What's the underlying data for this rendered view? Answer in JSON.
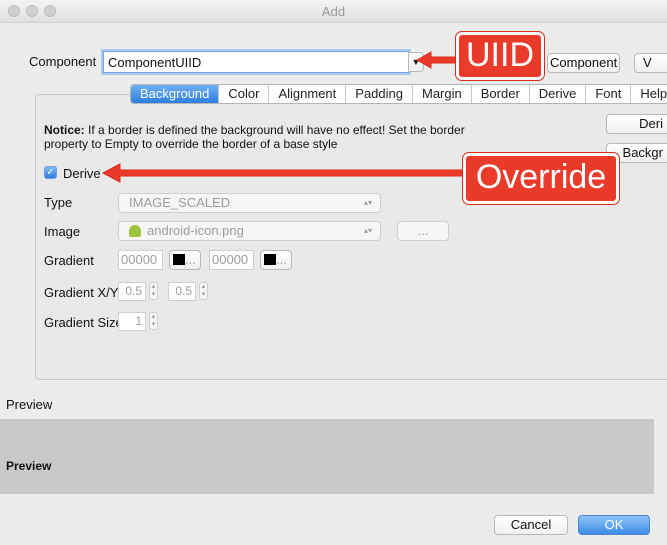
{
  "window": {
    "title": "Add"
  },
  "component": {
    "label": "Component",
    "value": "ComponentUIID",
    "help_button": "Component Help",
    "v_button": "V"
  },
  "tabs": [
    "Background",
    "Color",
    "Alignment",
    "Padding",
    "Margin",
    "Border",
    "Derive",
    "Font",
    "Help"
  ],
  "notice": {
    "bold": "Notice:",
    "line1": " If a border is defined the background will have no effect! Set the border",
    "line2": "property to Empty to override the border of a base style"
  },
  "side_buttons": {
    "derive": "Deri",
    "background": "Backgr"
  },
  "derive_checkbox": {
    "label": "Derive",
    "checked": true
  },
  "fields": {
    "type_label": "Type",
    "type_value": "IMAGE_SCALED",
    "image_label": "Image",
    "image_value": "android-icon.png",
    "image_browse": "...",
    "gradient_label": "Gradient",
    "gradient_color1": "00000",
    "gradient_color2": "00000",
    "color_button": "...",
    "gradient_xy_label": "Gradient X/Y",
    "gradient_x": "0.5",
    "gradient_y": "0.5",
    "gradient_size_label": "Gradient Size",
    "gradient_size": "1"
  },
  "preview": {
    "section_label": "Preview",
    "text": "Preview"
  },
  "footer": {
    "cancel": "Cancel",
    "ok": "OK"
  },
  "annotations": {
    "uiid": "UIID",
    "override": "Override"
  },
  "colors": {
    "accent": "#2d7fe3",
    "callout": "#ea3a2a",
    "android_green": "#9bc53d"
  }
}
